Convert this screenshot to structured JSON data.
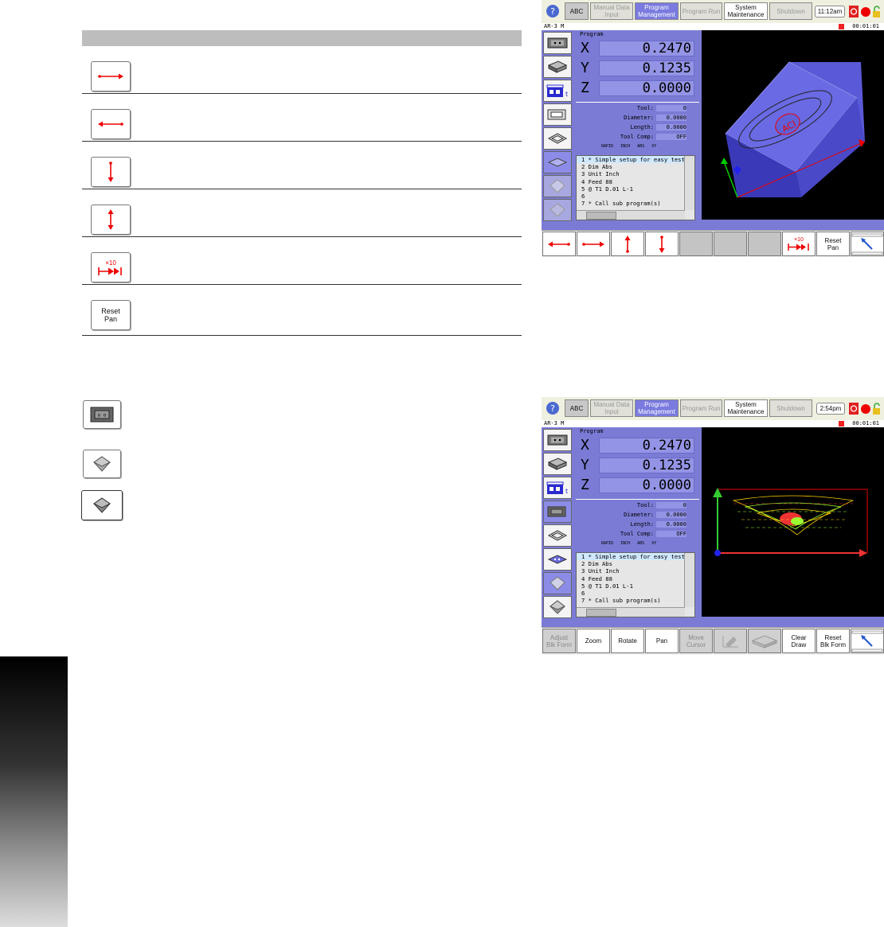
{
  "icons": {
    "arrow_right": "arrow-right-icon",
    "arrow_left": "arrow-left-icon",
    "arrow_down": "arrow-down-icon",
    "arrow_updown": "arrow-up-down-icon",
    "x10_skip": "x10-skip-icon"
  },
  "left_table": {
    "x10_label": "×10",
    "reset_pan": [
      "Reset",
      "Pan"
    ]
  },
  "screen1": {
    "topbar": {
      "help": "?",
      "abc": "ABC",
      "manual_data_input": [
        "Manual Data",
        "Input"
      ],
      "program_management": [
        "Program",
        "Management"
      ],
      "program_run": "Program Run",
      "system_maintenance": [
        "System",
        "Maintenance"
      ],
      "shutdown": "Shutdown",
      "time": "11:12am"
    },
    "status": {
      "mode": "AR-3 M",
      "timer": "00:01:01"
    },
    "section_title": "Program",
    "axes": [
      {
        "label": "X",
        "value": "0.2470"
      },
      {
        "label": "Y",
        "value": "0.1235"
      },
      {
        "label": "Z",
        "value": "0.0000"
      }
    ],
    "tool": {
      "tool_label": "Tool:",
      "tool_value": "0",
      "diameter_label": "Diameter:",
      "diameter_value": "0.0000",
      "length_label": "Length:",
      "length_value": "0.0000",
      "comp_label": "Tool Comp:",
      "comp_value": "OFF",
      "flags": [
        "RAPID",
        "INCH",
        "ABS",
        "XY"
      ]
    },
    "program_lines": [
      "1 * Simple setup for easy test",
      "2 Dim Abs",
      "3 Unit Inch",
      "4 Feed 88",
      "5 @ T1 D.01 L-1",
      "6",
      "7 * Call sub program(s)"
    ],
    "bottom": {
      "x10": "×10",
      "reset_pan": [
        "Reset",
        "Pan"
      ]
    },
    "logo_text": "ACI"
  },
  "screen2": {
    "topbar": {
      "help": "?",
      "abc": "ABC",
      "manual_data_input": [
        "Manual Data",
        "Input"
      ],
      "program_management": [
        "Program",
        "Management"
      ],
      "program_run": "Program Run",
      "system_maintenance": [
        "System",
        "Maintenance"
      ],
      "shutdown": "Shutdown",
      "time": "2:54pm"
    },
    "status": {
      "mode": "AR-3 M",
      "timer": "00:01:01"
    },
    "section_title": "Program",
    "axes": [
      {
        "label": "X",
        "value": "0.2470"
      },
      {
        "label": "Y",
        "value": "0.1235"
      },
      {
        "label": "Z",
        "value": "0.0000"
      }
    ],
    "tool": {
      "tool_label": "Tool:",
      "tool_value": "0",
      "diameter_label": "Diameter:",
      "diameter_value": "0.0000",
      "length_label": "Length:",
      "length_value": "0.0000",
      "comp_label": "Tool Comp:",
      "comp_value": "OFF",
      "flags": [
        "RAPID",
        "INCH",
        "ABS",
        "XY"
      ]
    },
    "program_lines": [
      "1 * Simple setup for easy test",
      "2 Dim Abs",
      "3 Unit Inch",
      "4 Feed 88",
      "5 @ T1 D.01 L-1",
      "6",
      "7 * Call sub program(s)"
    ],
    "bottom": {
      "adjust_blk": [
        "Adjust",
        "Blk Form"
      ],
      "zoom": "Zoom",
      "rotate": "Rotate",
      "pan": "Pan",
      "move_cursor": [
        "Move",
        "Cursor"
      ],
      "clear_draw": [
        "Clear",
        "Draw"
      ],
      "reset_blk": [
        "Reset",
        "Blk Form"
      ]
    }
  }
}
